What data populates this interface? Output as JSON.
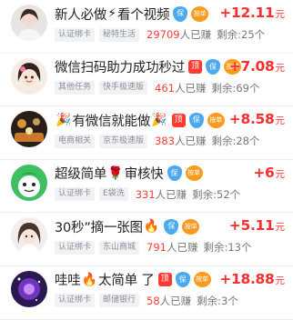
{
  "tasks": [
    {
      "title": "新人必做",
      "emoji": "⚡",
      "title_after": "看个视频",
      "badges": [
        "保",
        "按单"
      ],
      "reward": "+12.11",
      "unit": "元",
      "tags": [
        "认证绑卡",
        "秘特生活"
      ],
      "earned_count": "29709",
      "earned_label": "人已赚",
      "remaining": "剩余:25个"
    },
    {
      "title": "微信扫码助力成功秒过",
      "emoji": "",
      "title_after": "",
      "badges": [
        "顶",
        "保",
        "按单"
      ],
      "reward": "+7.08",
      "unit": "元",
      "tags": [
        "其他任务",
        "快手极速版"
      ],
      "earned_count": "461",
      "earned_label": "人已赚",
      "remaining": "剩余:69个"
    },
    {
      "title": "有微信就能做",
      "emoji_before": "🎉",
      "emoji": "🎉",
      "title_after": "",
      "badges": [
        "顶",
        "保",
        "按单"
      ],
      "reward": "+8.58",
      "unit": "元",
      "tags": [
        "电商相关",
        "京东极速版"
      ],
      "earned_count": "383",
      "earned_label": "人已赚",
      "remaining": "剩余:28个"
    },
    {
      "title": "超级简单",
      "emoji": "🌹",
      "title_after": "审核快",
      "badges": [
        "保",
        "按单"
      ],
      "reward": "+6",
      "unit": "元",
      "tags": [
        "认证绑卡",
        "E袋洗"
      ],
      "earned_count": "331",
      "earned_label": "人已赚",
      "remaining": "剩余:52个"
    },
    {
      "title": "30秒”摘一张图",
      "emoji": "🔥",
      "title_after": "",
      "badges": [
        "保",
        "按单"
      ],
      "reward": "+5.11",
      "unit": "元",
      "tags": [
        "认证绑卡",
        "东山商城"
      ],
      "earned_count": "791",
      "earned_label": "人已赚",
      "remaining": "剩余:13个"
    },
    {
      "title": "哇哇",
      "emoji": "🔥",
      "title_after": "太简单 了",
      "badges": [
        "顶",
        "保",
        "按单"
      ],
      "reward": "+18.88",
      "unit": "元",
      "tags": [
        "认证绑卡",
        "邮储银行"
      ],
      "earned_count": "58",
      "earned_label": "人已赚",
      "remaining": "剩余:3个"
    }
  ],
  "colors": {
    "reward": "#ff2d2d",
    "ding": "#ff3b2f",
    "bao": "#4aa9f0",
    "hongbao": "#ff9a1f",
    "tag_bg": "#f1f2f4"
  },
  "icons": [
    "avatar-girl",
    "avatar-cartoon-girl",
    "avatar-party-scene",
    "avatar-green-cartoon",
    "avatar-young-girl",
    "avatar-purple-night"
  ]
}
